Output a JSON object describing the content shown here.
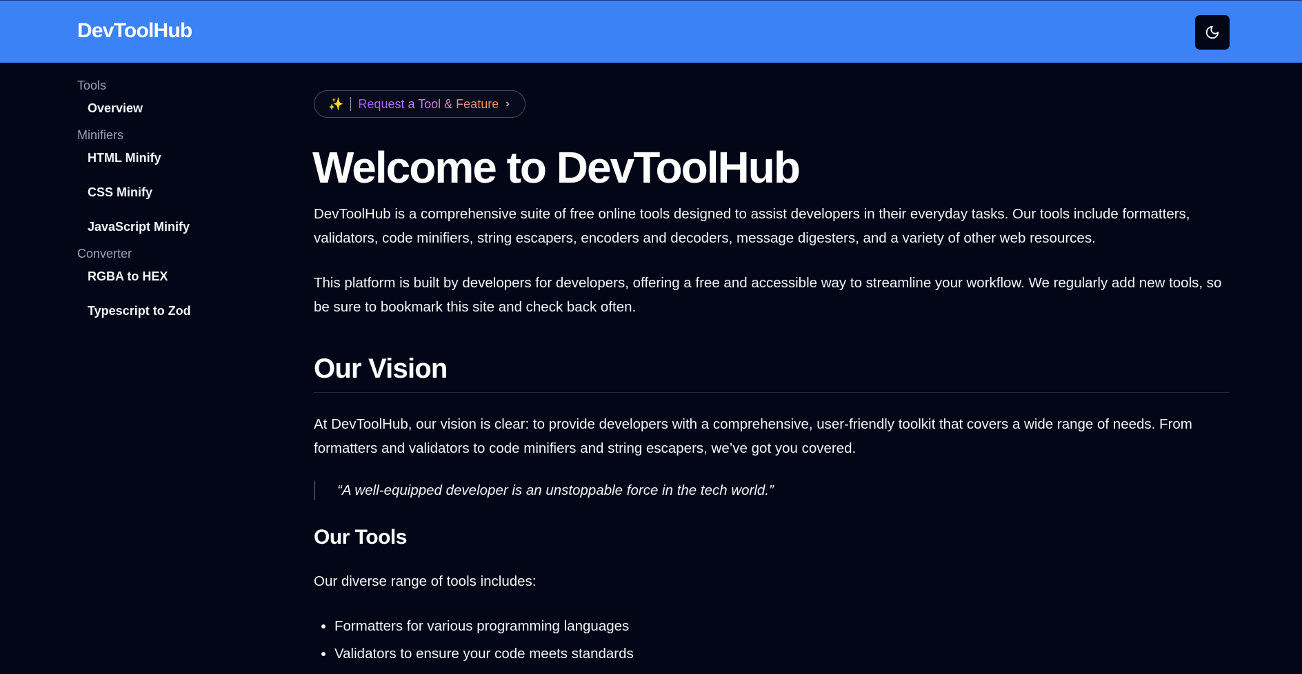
{
  "header": {
    "brand": "DevToolHub",
    "theme_toggle_icon": "moon-icon"
  },
  "sidebar": {
    "groups": [
      {
        "label": "Tools",
        "items": [
          "Overview"
        ]
      },
      {
        "label": "Minifiers",
        "items": [
          "HTML Minify",
          "CSS Minify",
          "JavaScript Minify"
        ]
      },
      {
        "label": "Converter",
        "items": [
          "RGBA to HEX",
          "Typescript to Zod"
        ]
      }
    ]
  },
  "main": {
    "request_pill": {
      "icon": "✨",
      "label": "Request a Tool & Feature",
      "chevron": "›"
    },
    "title": "Welcome to DevToolHub",
    "intro_paragraphs": [
      "DevToolHub is a comprehensive suite of free online tools designed to assist developers in their everyday tasks. Our tools include formatters, validators, code minifiers, string escapers, encoders and decoders, message digesters, and a variety of other web resources.",
      "This platform is built by developers for developers, offering a free and accessible way to streamline your workflow. We regularly add new tools, so be sure to bookmark this site and check back often."
    ],
    "vision": {
      "heading": "Our Vision",
      "paragraph": "At DevToolHub, our vision is clear: to provide developers with a comprehensive, user-friendly toolkit that covers a wide range of needs. From formatters and validators to code minifiers and string escapers, we’ve got you covered.",
      "quote": "“A well-equipped developer is an unstoppable force in the tech world.”"
    },
    "tools": {
      "heading": "Our Tools",
      "intro": "Our diverse range of tools includes:",
      "items": [
        "Formatters for various programming languages",
        "Validators to ensure your code meets standards"
      ]
    }
  },
  "colors": {
    "header_bg": "#3b82f6",
    "page_bg": "#020617",
    "muted_text": "#94a3b8",
    "text": "#f1f5f9"
  }
}
